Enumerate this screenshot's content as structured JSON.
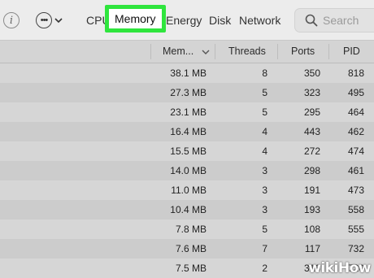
{
  "toolbar": {
    "info_icon": "info-icon",
    "more_icon": "ellipsis-circle-icon",
    "chevron_icon": "chevron-down-icon",
    "tabs": [
      "CPU",
      "Memory",
      "Energy",
      "Disk",
      "Network"
    ],
    "active_tab": "Memory",
    "highlight_color": "#2fe53d",
    "search_placeholder": "Search"
  },
  "table": {
    "columns": [
      "Mem...",
      "Threads",
      "Ports",
      "PID"
    ],
    "rows": [
      {
        "memory": "38.1 MB",
        "threads": "8",
        "ports": "350",
        "pid": "818"
      },
      {
        "memory": "27.3 MB",
        "threads": "5",
        "ports": "323",
        "pid": "495"
      },
      {
        "memory": "23.1 MB",
        "threads": "5",
        "ports": "295",
        "pid": "464"
      },
      {
        "memory": "16.4 MB",
        "threads": "4",
        "ports": "443",
        "pid": "462"
      },
      {
        "memory": "15.5 MB",
        "threads": "4",
        "ports": "272",
        "pid": "474"
      },
      {
        "memory": "14.0 MB",
        "threads": "3",
        "ports": "298",
        "pid": "461"
      },
      {
        "memory": "11.0 MB",
        "threads": "3",
        "ports": "191",
        "pid": "473"
      },
      {
        "memory": "10.4 MB",
        "threads": "3",
        "ports": "193",
        "pid": "558"
      },
      {
        "memory": "7.8 MB",
        "threads": "5",
        "ports": "108",
        "pid": "555"
      },
      {
        "memory": "7.6 MB",
        "threads": "7",
        "ports": "117",
        "pid": "732"
      },
      {
        "memory": "7.5 MB",
        "threads": "2",
        "ports": "316",
        "pid": "720"
      }
    ]
  },
  "watermark": "wikiHow"
}
